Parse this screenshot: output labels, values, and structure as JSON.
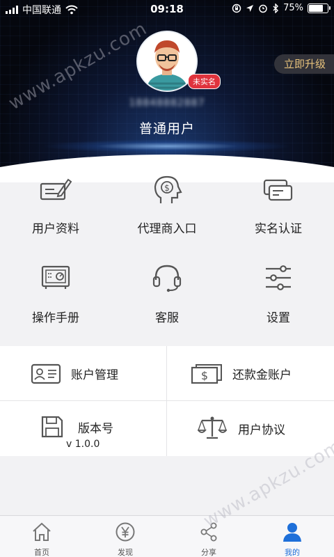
{
  "status_bar": {
    "carrier": "中国联通",
    "time": "09:18",
    "battery_percent": "75%",
    "battery_level": 0.75,
    "icons": [
      "signal-icon",
      "wifi-icon",
      "orientation-lock-icon",
      "location-icon",
      "alarm-icon",
      "bluetooth-icon",
      "battery-icon"
    ]
  },
  "profile": {
    "verify_badge": "未实名",
    "upgrade_label": "立即升级",
    "phone_masked": "18848882887",
    "user_level": "普通用户"
  },
  "grid": [
    {
      "label": "用户资料",
      "icon": "profile-edit-icon"
    },
    {
      "label": "代理商入口",
      "icon": "agent-head-icon"
    },
    {
      "label": "实名认证",
      "icon": "cards-icon"
    },
    {
      "label": "操作手册",
      "icon": "safe-box-icon"
    },
    {
      "label": "客服",
      "icon": "headset-icon"
    },
    {
      "label": "设置",
      "icon": "sliders-icon"
    }
  ],
  "list": [
    {
      "label": "账户管理",
      "icon": "id-card-icon"
    },
    {
      "label": "还款金账户",
      "icon": "cash-icon"
    },
    {
      "label": "版本号",
      "sub": "v 1.0.0",
      "icon": "floppy-icon"
    },
    {
      "label": "用户协议",
      "icon": "scale-icon"
    }
  ],
  "tabbar": [
    {
      "label": "首页",
      "icon": "home-icon"
    },
    {
      "label": "发现",
      "icon": "yen-icon"
    },
    {
      "label": "分享",
      "icon": "share-icon"
    },
    {
      "label": "我的",
      "icon": "user-icon",
      "active": true
    }
  ],
  "watermark": "www.apkzu.com",
  "colors": {
    "accent": "#1e6fd9",
    "badge": "#e0333d",
    "upgrade_text": "#e7c27c",
    "icon_gray": "#555555"
  }
}
